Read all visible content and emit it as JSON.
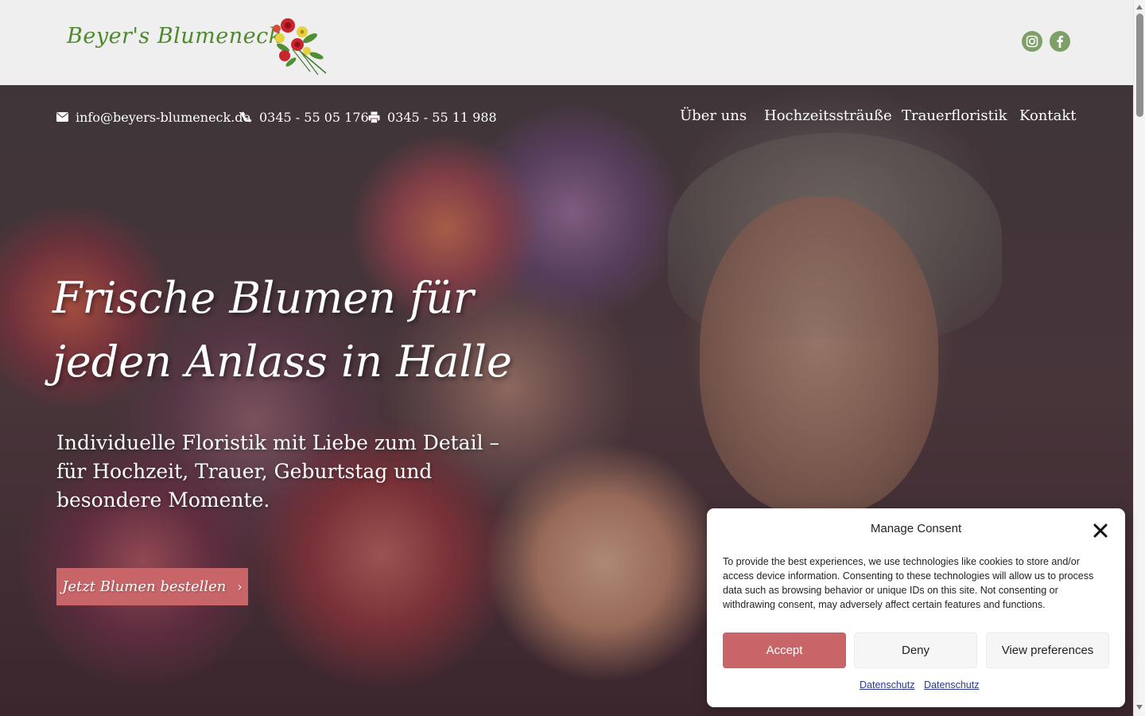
{
  "header": {
    "logo_text": "Beyer's Blumeneck",
    "social": {
      "instagram": "instagram-icon",
      "facebook": "facebook-icon"
    },
    "social_color": "#7da067"
  },
  "topbar": {
    "email": "info@beyers-blumeneck.de",
    "phone": "0345 - 55 05 176",
    "fax": "0345 - 55 11 988"
  },
  "nav": {
    "items": [
      {
        "label": "Über uns"
      },
      {
        "label": "Hochzeitssträuße"
      },
      {
        "label": "Trauerfloristik"
      },
      {
        "label": "Kontakt"
      }
    ]
  },
  "hero": {
    "title_line1": "Frische Blumen für",
    "title_line2": "jeden Anlass in Halle",
    "subtitle": "Individuelle Floristik mit Liebe zum Detail – für Hochzeit, Trauer, Geburtstag und besondere Momente.",
    "cta_label": "Jetzt Blumen bestellen",
    "cta_icon": "chevron-right-icon"
  },
  "consent": {
    "title": "Manage Consent",
    "body": "To provide the best experiences, we use technologies like cookies to store and/or access device information. Consenting to these technologies will allow us to process data such as browsing behavior or unique IDs on this site. Not consenting or withdrawing consent, may adversely affect certain features and functions.",
    "accept_label": "Accept",
    "deny_label": "Deny",
    "preferences_label": "View preferences",
    "links": [
      {
        "label": "Datenschutz"
      },
      {
        "label": "Datenschutz"
      }
    ]
  },
  "colors": {
    "accent": "#c86568",
    "logo_green": "#4e8a2b",
    "header_bg": "#efefef"
  }
}
